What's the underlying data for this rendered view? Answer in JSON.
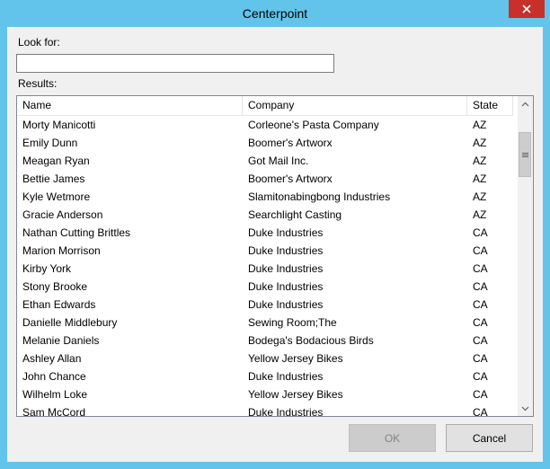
{
  "window": {
    "title": "Centerpoint"
  },
  "search": {
    "label": "Look for:",
    "value": "",
    "placeholder": ""
  },
  "results": {
    "label": "Results:",
    "columns": [
      "Name",
      "Company",
      "State"
    ],
    "rows": [
      [
        "Morty Manicotti",
        "Corleone's Pasta Company",
        "AZ"
      ],
      [
        "Emily Dunn",
        "Boomer's Artworx",
        "AZ"
      ],
      [
        "Meagan Ryan",
        "Got Mail Inc.",
        "AZ"
      ],
      [
        "Bettie James",
        "Boomer's Artworx",
        "AZ"
      ],
      [
        "Kyle Wetmore",
        "Slamitonabingbong Industries",
        "AZ"
      ],
      [
        "Gracie Anderson",
        "Searchlight Casting",
        "AZ"
      ],
      [
        "Nathan Cutting Brittles",
        "Duke Industries",
        "CA"
      ],
      [
        "Marion Morrison",
        "Duke Industries",
        "CA"
      ],
      [
        "Kirby York",
        "Duke Industries",
        "CA"
      ],
      [
        "Stony Brooke",
        "Duke Industries",
        "CA"
      ],
      [
        "Ethan Edwards",
        "Duke Industries",
        "CA"
      ],
      [
        "Danielle Middlebury",
        "Sewing Room;The",
        "CA"
      ],
      [
        "Melanie Daniels",
        "Bodega's Bodacious Birds",
        "CA"
      ],
      [
        "Ashley Allan",
        "Yellow Jersey Bikes",
        "CA"
      ],
      [
        "John Chance",
        "Duke Industries",
        "CA"
      ],
      [
        "Wilhelm Loke",
        "Yellow Jersey Bikes",
        "CA"
      ],
      [
        "Sam McCord",
        "Duke Industries",
        "CA"
      ]
    ]
  },
  "buttons": {
    "ok": "OK",
    "cancel": "Cancel"
  },
  "colors": {
    "frame": "#62c4ea",
    "close_button": "#c7302b",
    "disabled_text": "#838383"
  },
  "icons": {
    "close": "close-icon",
    "scroll_up": "chevron-up-icon",
    "scroll_down": "chevron-down-icon",
    "thumb_grip": "grip-icon"
  }
}
